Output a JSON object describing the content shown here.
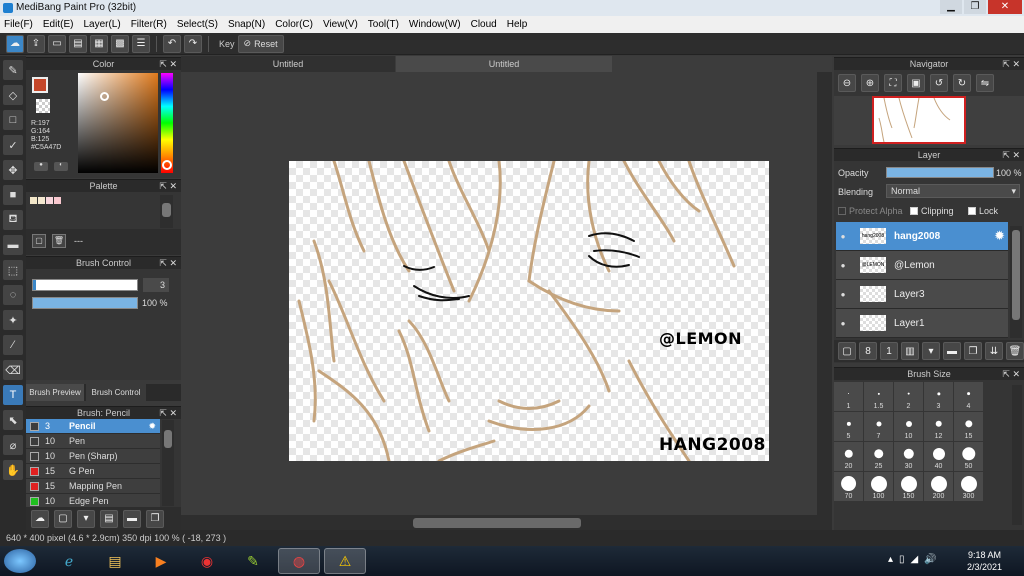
{
  "window": {
    "title": "MediBang Paint Pro (32bit)"
  },
  "menu": [
    "File(F)",
    "Edit(E)",
    "Layer(L)",
    "Filter(R)",
    "Select(S)",
    "Snap(N)",
    "Color(C)",
    "View(V)",
    "Tool(T)",
    "Window(W)",
    "Cloud",
    "Help"
  ],
  "toolbar": {
    "key_label": "Key",
    "reset_label": "Reset"
  },
  "color_panel": {
    "title": "Color",
    "r": "R:197",
    "g": "G:164",
    "b": "B:125",
    "hex": "#C5A47D",
    "fg_color": "#c5472a",
    "accent": "#C5A47D"
  },
  "palette_panel": {
    "title": "Palette",
    "dashes": "---",
    "swatches": [
      "#f2e6c8",
      "#f4e8d0",
      "#f8d6dc",
      "#f9c8cf"
    ]
  },
  "brush_control": {
    "title": "Brush Control",
    "size": "3",
    "opacity": "100 %"
  },
  "brush_tabs": {
    "preview": "Brush Preview",
    "control": "Brush Control"
  },
  "brush_list": {
    "title": "Brush: Pencil",
    "items": [
      {
        "size": "3",
        "name": "Pencil",
        "color": "#3c3c3c"
      },
      {
        "size": "10",
        "name": "Pen",
        "color": "#3c3c3c"
      },
      {
        "size": "10",
        "name": "Pen (Sharp)",
        "color": "#3c3c3c"
      },
      {
        "size": "15",
        "name": "G Pen",
        "color": "#e02020"
      },
      {
        "size": "15",
        "name": "Mapping Pen",
        "color": "#e02020"
      },
      {
        "size": "10",
        "name": "Edge Pen",
        "color": "#20c020"
      }
    ]
  },
  "doc_tabs": [
    "Untitled",
    "Untitled"
  ],
  "watermarks": {
    "lemon": "@LEMON",
    "hang": "HANG2008"
  },
  "navigator": {
    "title": "Navigator"
  },
  "layer_panel": {
    "title": "Layer",
    "opacity_label": "Opacity",
    "opacity_value": "100 %",
    "blending_label": "Blending",
    "blending_value": "Normal",
    "protect_alpha": "Protect Alpha",
    "clipping": "Clipping",
    "lock": "Lock",
    "layers": [
      {
        "name": "hang2008",
        "thumb": "hang2008"
      },
      {
        "name": "@Lemon",
        "thumb": "@LEMON"
      },
      {
        "name": "Layer3",
        "thumb": ""
      },
      {
        "name": "Layer1",
        "thumb": ""
      }
    ]
  },
  "brush_size": {
    "title": "Brush Size",
    "sizes": [
      "1",
      "1.5",
      "2",
      "3",
      "4",
      "5",
      "7",
      "10",
      "12",
      "15",
      "20",
      "25",
      "30",
      "40",
      "50",
      "70",
      "100",
      "150",
      "200",
      "300"
    ]
  },
  "status": {
    "text": "640 * 400 pixel   (4.6 * 2.9cm)   350 dpi   100 %   ( -18, 273 )"
  },
  "clock": {
    "time": "9:18 AM",
    "date": "2/3/2021"
  }
}
